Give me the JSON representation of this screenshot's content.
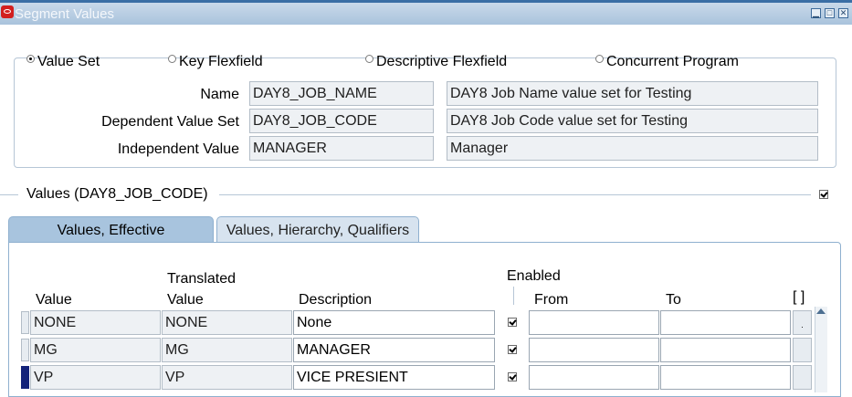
{
  "window": {
    "title": "Segment Values"
  },
  "type_options": [
    {
      "label": "Value Set",
      "selected": true
    },
    {
      "label": "Key Flexfield",
      "selected": false
    },
    {
      "label": "Descriptive Flexfield",
      "selected": false
    },
    {
      "label": "Concurrent Program",
      "selected": false
    }
  ],
  "fields": {
    "name": {
      "label": "Name",
      "value": "DAY8_JOB_NAME",
      "description": "DAY8 Job Name value set for Testing"
    },
    "dependent": {
      "label": "Dependent Value Set",
      "value": "DAY8_JOB_CODE",
      "description": "DAY8 Job Code value set for Testing"
    },
    "independent": {
      "label": "Independent Value",
      "value": "MANAGER",
      "description": "Manager"
    }
  },
  "values_section": {
    "title": "Values (DAY8_JOB_CODE)",
    "checked": true
  },
  "tabs": [
    {
      "label": "Values, Effective",
      "active": true
    },
    {
      "label": "Values, Hierarchy, Qualifiers",
      "active": false
    }
  ],
  "columns": {
    "value": "Value",
    "translated_top": "Translated",
    "translated_bottom": "Value",
    "description": "Description",
    "enabled": "Enabled",
    "from": "From",
    "to": "To",
    "flex": "[ ]"
  },
  "rows": [
    {
      "value": "NONE",
      "translated": "NONE",
      "description": "None",
      "enabled": true,
      "from": "",
      "to": ""
    },
    {
      "value": "MG",
      "translated": "MG",
      "description": "MANAGER",
      "enabled": true,
      "from": "",
      "to": ""
    },
    {
      "value": "VP",
      "translated": "VP",
      "description": "VICE PRESIENT",
      "enabled": true,
      "from": "",
      "to": ""
    }
  ],
  "current_row": 2,
  "icons": {
    "app": "oracle-icon",
    "minimize": "minimize-icon",
    "maximize": "maximize-icon",
    "close": "close-icon",
    "scroll_up": "scroll-up-arrow-icon"
  }
}
